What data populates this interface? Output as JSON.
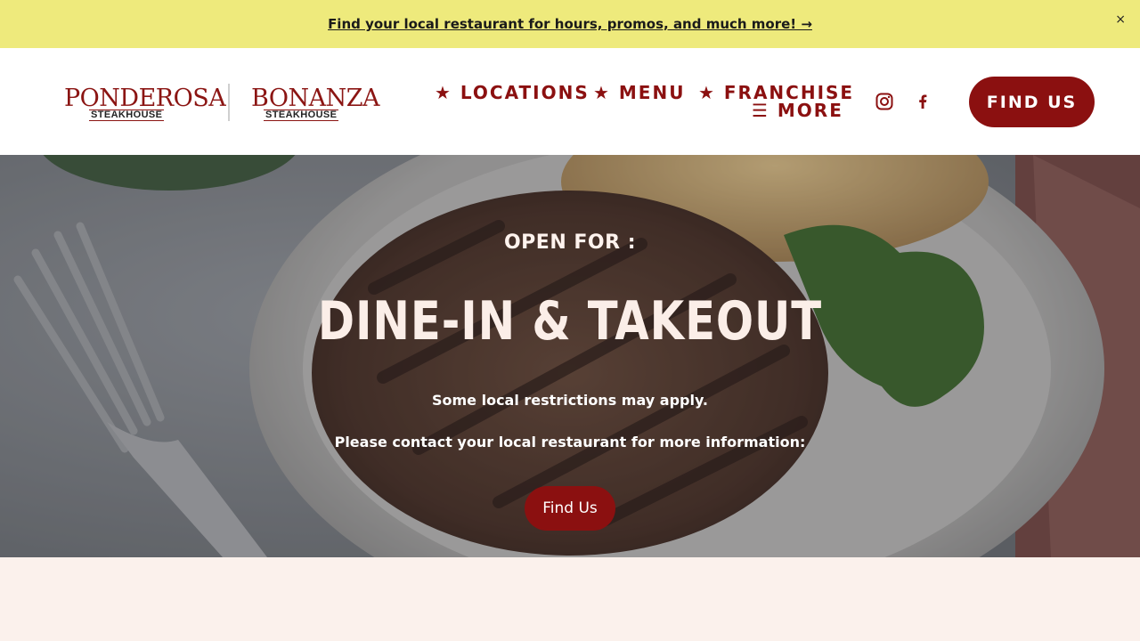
{
  "promo_bar": {
    "link_text": "Find your local restaurant for hours, promos, and much more! →",
    "close_label": "×",
    "background": "#eeea7c"
  },
  "header": {
    "logo_primary": "PONDEROSA",
    "logo_primary_sub": "STEAKHOUSE",
    "logo_secondary": "BONANZA",
    "logo_secondary_sub": "STEAKHOUSE",
    "nav": [
      {
        "label": "★ LOCATIONS"
      },
      {
        "label": "★ MENU"
      },
      {
        "label": "★ FRANCHISE"
      },
      {
        "label": "☰ MORE"
      }
    ],
    "social_icons": [
      "instagram-icon",
      "facebook-icon"
    ],
    "cta_label": "FIND US",
    "accent_color": "#8b1010"
  },
  "hero": {
    "eyebrow": "OPEN FOR :",
    "title": "DINE-IN & TAKEOUT",
    "line1": "Some local restrictions may apply.",
    "line2": "Please contact your local restaurant for more information:",
    "button_label": "Find Us"
  }
}
